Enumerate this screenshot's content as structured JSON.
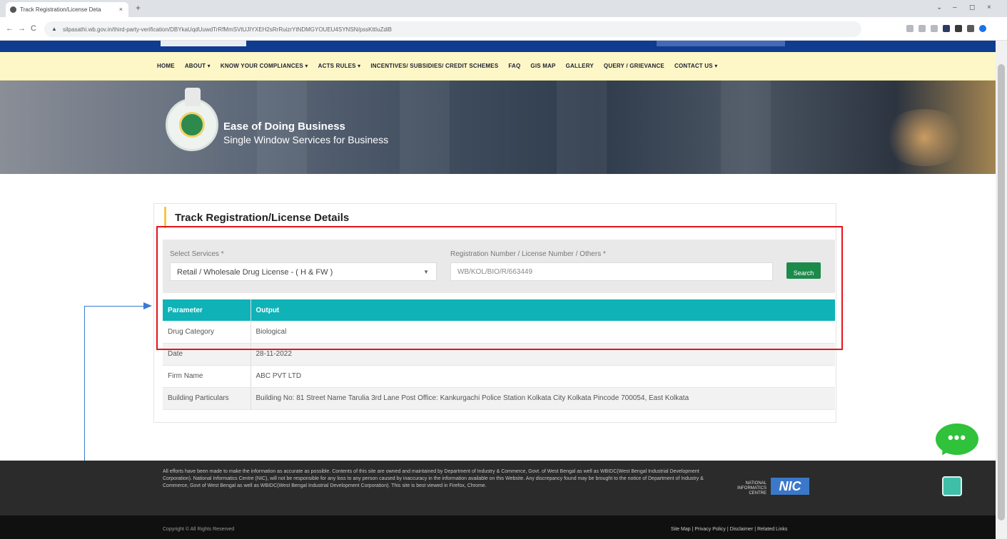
{
  "browser": {
    "tab_title": "Track Registration/License Deta",
    "tab_close": "×",
    "new_tab": "+",
    "url": "silpasathi.wb.gov.in/third-party-verification/DBYkaUqdUuwdTrRfMmSVtUJIYXEH2sRrRuizrYtNDMGYOUEU4SYNSN/pssKttIuZdiB",
    "back": "←",
    "forward": "→",
    "reload": "C",
    "lock": "▲",
    "window_controls": [
      "⌄",
      "–",
      "◻",
      "×"
    ]
  },
  "nav": {
    "items": [
      "HOME",
      "ABOUT ▾",
      "KNOW YOUR COMPLIANCES ▾",
      "ACTS RULES ▾",
      "INCENTIVES/ SUBSIDIES/ CREDIT SCHEMES",
      "FAQ",
      "GIS MAP",
      "GALLERY",
      "QUERY / GRIEVANCE",
      "CONTACT US ▾"
    ]
  },
  "banner": {
    "title": "Ease of Doing Business",
    "subtitle": "Single Window Services for Business"
  },
  "track": {
    "title": "Track Registration/License Details",
    "service_label": "Select Services *",
    "service_value": "Retail / Wholesale Drug License - ( H & FW )",
    "service_chevron": "▼",
    "reg_label": "Registration Number / License Number / Others *",
    "reg_value": "WB/KOL/BIO/R/663449",
    "search_label": "Search"
  },
  "results": {
    "headers": [
      "Parameter",
      "Output"
    ],
    "rows": [
      [
        "Drug Category",
        "Biological"
      ],
      [
        "Date",
        "28-11-2022"
      ],
      [
        "Firm Name",
        "ABC PVT LTD"
      ],
      [
        "Building Particulars",
        "Building No: 81 Street Name Tarulia 3rd Lane Post Office: Kankurgachi Police Station Kolkata City Kolkata Pincode 700054, East Kolkata"
      ]
    ]
  },
  "footer": {
    "disclaimer": "All efforts have been made to make the information as accurate as possible. Contents of this site are owned and maintained by Department of Industry & Commerce, Govt. of West Bengal as well as WBIDC(West Bengal Industrial Development Corporation). National Informatics Centre (NIC), will not be responsible for any loss to any person caused by inaccuracy in the information available on this Website. Any discrepancy found may be brought to the notice of Department of Industry & Commerce, Govt of West Bengal as well as WBIDC(West Bengal Industrial Development Corporation). This site is best viewed in Firefox, Chrome.",
    "nic_text": "NATIONAL INFORMATICS CENTRE",
    "nic_mark": "NIC",
    "copyright": "Copyright © All Rights Reserved",
    "links": "Site Map | Privacy Policy | Disclaimer | Related Links"
  },
  "chat": {
    "dots": "•••"
  },
  "colors": {
    "accent_teal": "#0fb2b7",
    "search_green": "#1c8a4a",
    "highlight_red": "#e3141b",
    "arrow_blue": "#3a7bd5"
  }
}
